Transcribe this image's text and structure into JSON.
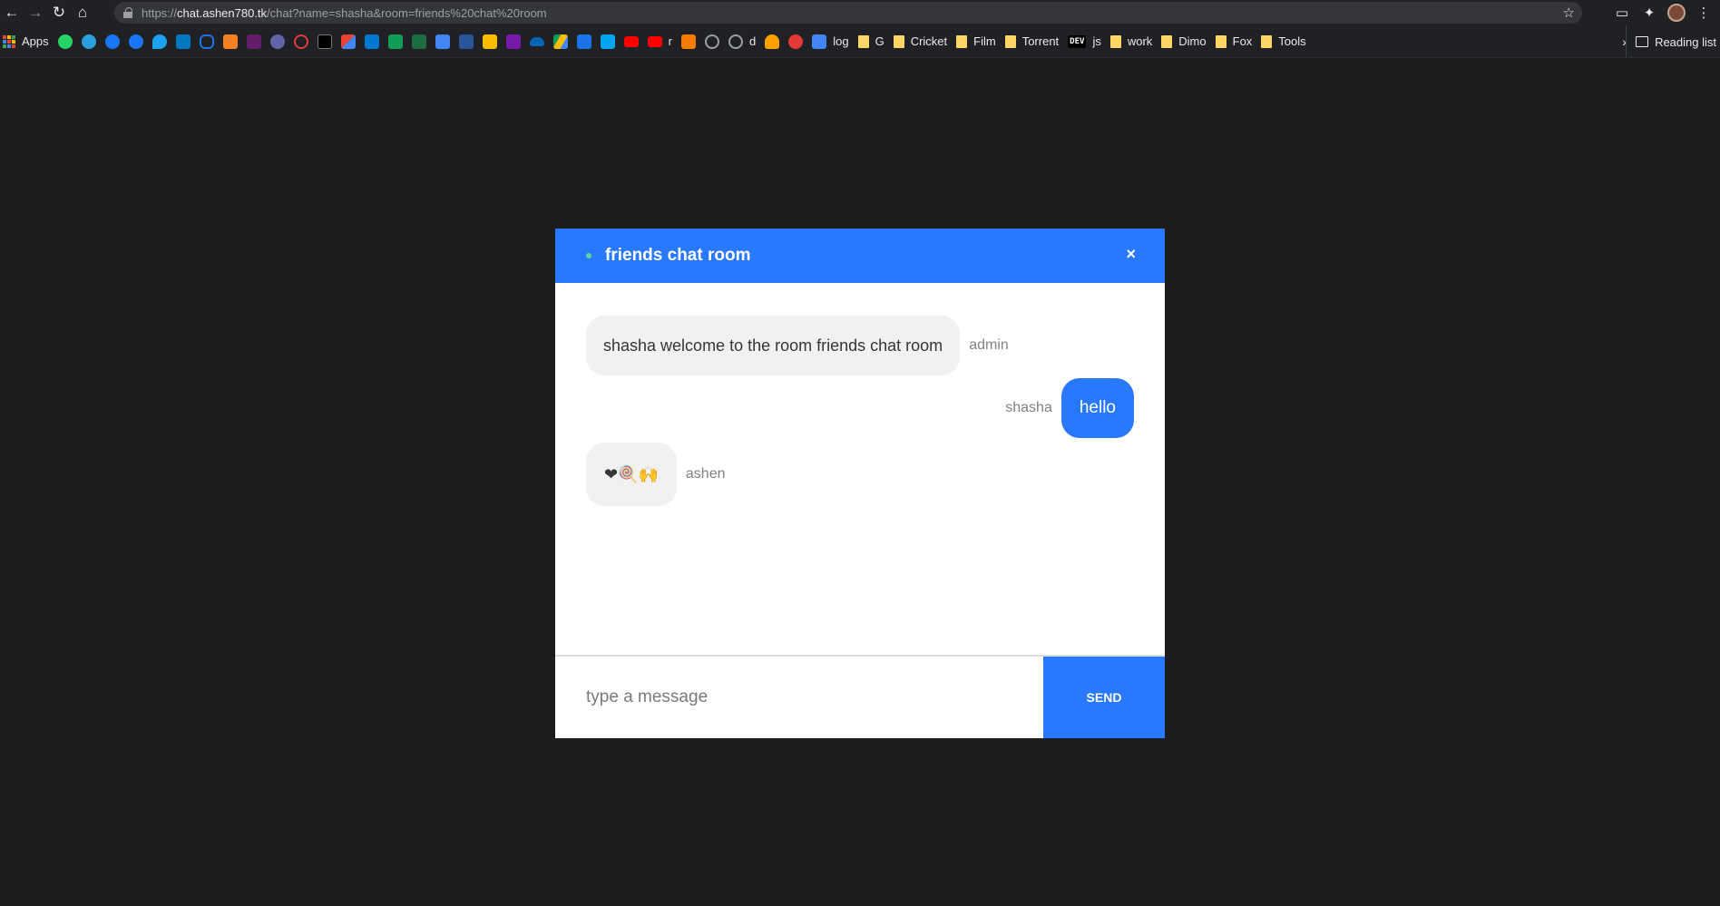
{
  "browser": {
    "url_scheme": "https://",
    "url_host": "chat.ashen780.tk",
    "url_path": "/chat?name=shasha&room=friends%20chat%20room",
    "bookmarks": {
      "apps": "Apps",
      "r": "r",
      "d": "d",
      "log": "log",
      "g": "G",
      "cricket": "Cricket",
      "film": "Film",
      "torrent": "Torrent",
      "dev_badge": "DEV",
      "js": "js",
      "work": "work",
      "dimo": "Dimo",
      "fox": "Fox",
      "tools": "Tools",
      "overflow": "»",
      "reading_list": "Reading list"
    }
  },
  "chat": {
    "room_title": "friends chat room",
    "close_glyph": "×",
    "messages": [
      {
        "sender": "admin",
        "text": "shasha welcome to the room friends chat room",
        "side": "left"
      },
      {
        "sender": "shasha",
        "text": "hello",
        "side": "right"
      },
      {
        "sender": "ashen",
        "text": "❤🍭🙌",
        "side": "left"
      }
    ],
    "input_placeholder": "type a message",
    "send_label": "SEND"
  },
  "colors": {
    "accent": "#2979ff",
    "page_bg": "#1c1c1e",
    "bubble_in": "#f1f1f1"
  }
}
